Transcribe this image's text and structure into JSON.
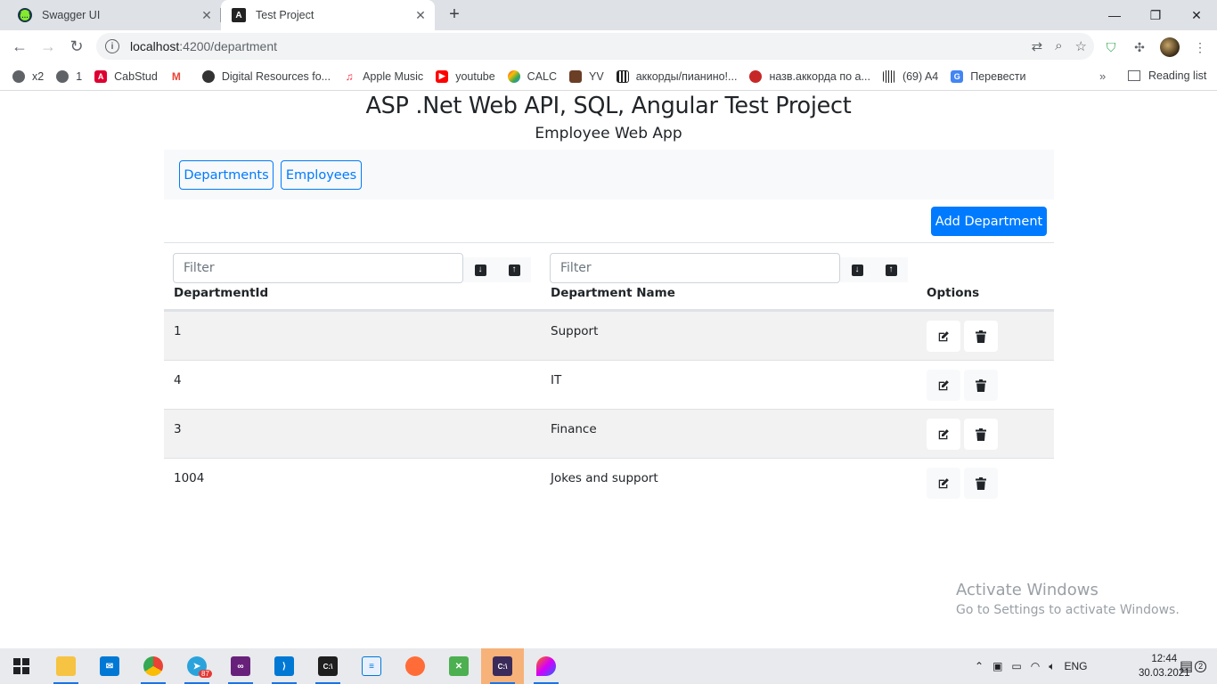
{
  "browser": {
    "tabs": [
      {
        "title": "Swagger UI",
        "active": false
      },
      {
        "title": "Test Project",
        "active": true
      }
    ],
    "address": {
      "host": "localhost",
      "path": ":4200/department"
    },
    "bookmarks": [
      {
        "label": "x2",
        "icon": "globe-icon"
      },
      {
        "label": "1",
        "icon": "globe-icon"
      },
      {
        "label": "CabStud",
        "icon": "angular-icon"
      },
      {
        "label": "",
        "icon": "gmail-icon"
      },
      {
        "label": "Digital Resources fo...",
        "icon": "resource-icon"
      },
      {
        "label": "Apple Music",
        "icon": "music-icon"
      },
      {
        "label": "youtube",
        "icon": "youtube-icon"
      },
      {
        "label": "CALC",
        "icon": "calc-icon"
      },
      {
        "label": "YV",
        "icon": "yv-icon"
      },
      {
        "label": "аккорды/пианино!...",
        "icon": "piano-icon"
      },
      {
        "label": "назв.аккорда по а...",
        "icon": "chord-icon"
      },
      {
        "label": "(69) A4",
        "icon": "barcode-icon"
      },
      {
        "label": "Перевести",
        "icon": "translate-icon"
      }
    ],
    "reading_list": "Reading list",
    "more": "»"
  },
  "app": {
    "title": "ASP .Net Web API, SQL, Angular Test Project",
    "subtitle": "Employee Web App",
    "nav": {
      "departments": "Departments",
      "employees": "Employees"
    },
    "add_button": "Add Department",
    "filters": {
      "id_placeholder": "Filter",
      "name_placeholder": "Filter"
    },
    "columns": {
      "id": "DepartmentId",
      "name": "Department Name",
      "options": "Options"
    },
    "rows": [
      {
        "id": "1",
        "name": "Support"
      },
      {
        "id": "4",
        "name": "IT"
      },
      {
        "id": "3",
        "name": "Finance"
      },
      {
        "id": "1004",
        "name": "Jokes and support"
      }
    ]
  },
  "watermark": {
    "line1": "Activate Windows",
    "line2": "Go to Settings to activate Windows."
  },
  "taskbar": {
    "lang": "ENG",
    "time": "12:44",
    "date": "30.03.2021",
    "telegram_badge": "87",
    "notifications": "2"
  },
  "colors": {
    "primary": "#007bff",
    "navbar_bg": "#f8f9fa",
    "stripe": "#f2f2f2"
  }
}
